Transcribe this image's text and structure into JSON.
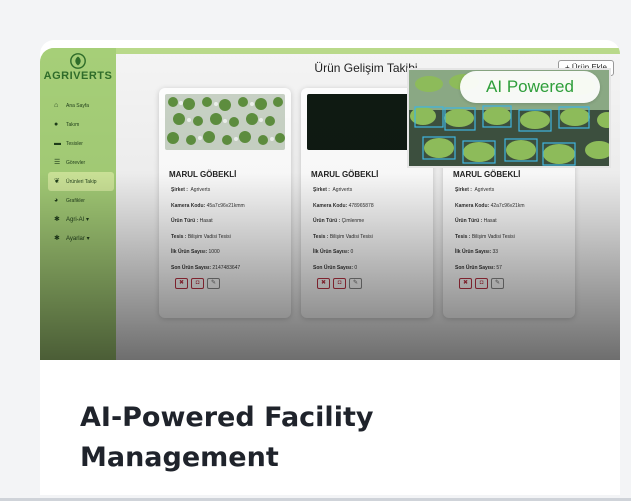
{
  "brand": {
    "logo_text": "AGRIVERTS"
  },
  "sidebar": {
    "items": [
      {
        "label": "Ana Sayfa",
        "icon": "home-icon"
      },
      {
        "label": "Takım",
        "icon": "team-icon"
      },
      {
        "label": "Tesisler",
        "icon": "folder-icon"
      },
      {
        "label": "Görevler",
        "icon": "list-icon"
      },
      {
        "label": "Ürünleri Takip",
        "icon": "leaf-icon",
        "active": true
      },
      {
        "label": "Grafikler",
        "icon": "chart-icon"
      },
      {
        "label": "Agri-AI",
        "icon": "gear-icon",
        "dropdown": true
      },
      {
        "label": "Ayarlar",
        "icon": "settings-icon",
        "dropdown": true
      }
    ]
  },
  "header": {
    "title": "Ürün Gelişim Takibi",
    "add_button": "+ Ürün Ekle"
  },
  "badge": {
    "label": "AI Powered"
  },
  "labels": {
    "company": "Şirket :",
    "camera": "Kamera Kodu:",
    "product_type": "Ürün Türü :",
    "facility": "Tesis :",
    "first_count": "İlk Ürün Sayısı:",
    "last_count": "Son Ürün Sayısı:"
  },
  "products": [
    {
      "name": "MARUL GÖBEKLİ",
      "company": "Agriverts",
      "camera": "45a7c96v21kmm",
      "product_type": "Hasat",
      "facility": "Bilişim Vadisi Tesisi",
      "first_count": "1000",
      "last_count": "2147483647"
    },
    {
      "name": "MARUL GÖBEKLİ",
      "company": "Agriverts",
      "camera": "478965878",
      "product_type": "Çimlenme",
      "facility": "Bilişim Vadisi Tesisi",
      "first_count": "0",
      "last_count": "0"
    },
    {
      "name": "MARUL GÖBEKLİ",
      "company": "Agriverts",
      "camera": "42a7c96v21km",
      "product_type": "Hasat",
      "facility": "Bilişim Vadisi Tesisi",
      "first_count": "33",
      "last_count": "57"
    }
  ],
  "actions": {
    "delete_icon": "trash-icon",
    "camera_icon": "camera-icon",
    "edit_icon": "edit-icon"
  },
  "feature": {
    "heading_line1": "AI-Powered Facility",
    "heading_line2": "Management"
  },
  "colors": {
    "sidebar": "#a6cf78",
    "accent_green": "#2e9e3a",
    "heading": "#1f232b"
  }
}
